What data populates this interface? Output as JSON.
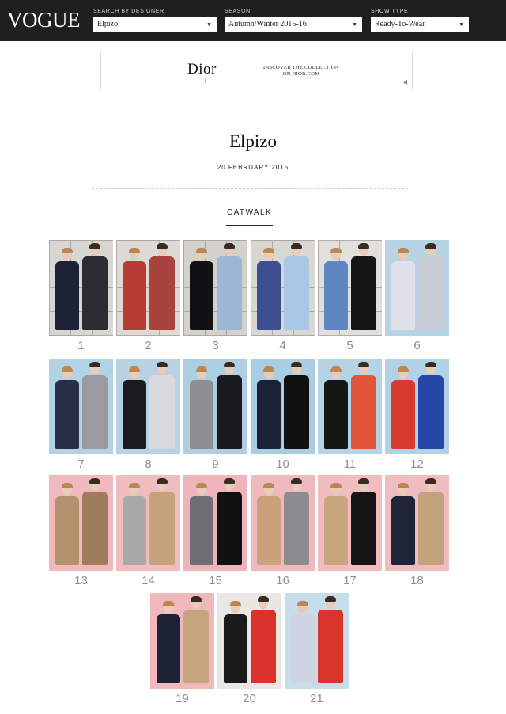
{
  "header": {
    "logo": "VOGUE",
    "filters": [
      {
        "label": "SEARCH BY DESIGNER",
        "value": "Elpizo"
      },
      {
        "label": "SEASON",
        "value": "Autumn/Winter 2015-16"
      },
      {
        "label": "SHOW TYPE",
        "value": "Ready-To-Wear"
      }
    ],
    "caret": "▼"
  },
  "ad": {
    "brand": "Dior",
    "cta_line1": "DISCOVER THE COLLECTION",
    "cta_line2": "ON DIOR.COM",
    "speaker_icon": "speaker-icon"
  },
  "show": {
    "title": "Elpizo",
    "date": "20 FEBRUARY 2015",
    "tab": "CATWALK"
  },
  "looks": [
    {
      "number": "1",
      "bg": "#d8d6d2",
      "pattern": "grid",
      "outfits": [
        "#1d2236",
        "#2c2c30"
      ]
    },
    {
      "number": "2",
      "bg": "#dddad5",
      "pattern": "grid",
      "outfits": [
        "#b83a35",
        "#a8433e"
      ]
    },
    {
      "number": "3",
      "bg": "#d3d1cc",
      "pattern": "grid",
      "outfits": [
        "#111114",
        "#9ab8d6"
      ]
    },
    {
      "number": "4",
      "bg": "#d9d7d2",
      "pattern": "grid",
      "outfits": [
        "#3c4f8e",
        "#a9c8e8"
      ]
    },
    {
      "number": "5",
      "bg": "#e2e0dc",
      "pattern": "grid",
      "outfits": [
        "#5f86c2",
        "#151515"
      ]
    },
    {
      "number": "6",
      "bg": "#b8d4e4",
      "pattern": "plain",
      "outfits": [
        "#dfe2e8",
        "#c7ccd6"
      ]
    },
    {
      "number": "7",
      "bg": "#b3d2e3",
      "pattern": "plain",
      "outfits": [
        "#2a2f45",
        "#9a9aa0"
      ]
    },
    {
      "number": "8",
      "bg": "#b7d3e3",
      "pattern": "plain",
      "outfits": [
        "#1b1b1f",
        "#d9d9dd"
      ]
    },
    {
      "number": "9",
      "bg": "#aecfe2",
      "pattern": "plain",
      "outfits": [
        "#8f8f92",
        "#1a1a1d"
      ]
    },
    {
      "number": "10",
      "bg": "#a9cde3",
      "pattern": "plain",
      "outfits": [
        "#1b2236",
        "#111111"
      ]
    },
    {
      "number": "11",
      "bg": "#b4d3e4",
      "pattern": "plain",
      "outfits": [
        "#151515",
        "#e2553a"
      ]
    },
    {
      "number": "12",
      "bg": "#b1d1e4",
      "pattern": "plain",
      "outfits": [
        "#d83a2d",
        "#2747a8"
      ]
    },
    {
      "number": "13",
      "bg": "#efb9bd",
      "pattern": "plain",
      "outfits": [
        "#b4906c",
        "#a07c5c"
      ]
    },
    {
      "number": "14",
      "bg": "#efbcc0",
      "pattern": "plain",
      "outfits": [
        "#a9a9a9",
        "#c5a27c"
      ]
    },
    {
      "number": "15",
      "bg": "#edb5bb",
      "pattern": "plain",
      "outfits": [
        "#6e6e74",
        "#111111"
      ]
    },
    {
      "number": "16",
      "bg": "#eeb9bc",
      "pattern": "plain",
      "outfits": [
        "#c9a27b",
        "#8c8c90"
      ]
    },
    {
      "number": "17",
      "bg": "#f0bcc0",
      "pattern": "plain",
      "outfits": [
        "#c8a57e",
        "#141414"
      ]
    },
    {
      "number": "18",
      "bg": "#efbcc0",
      "pattern": "plain",
      "outfits": [
        "#1f2438",
        "#c4a27d"
      ]
    },
    {
      "number": "19",
      "bg": "#eeb8bc",
      "pattern": "plain",
      "outfits": [
        "#1c2236",
        "#c7a57f"
      ]
    },
    {
      "number": "20",
      "bg": "#e9e7e4",
      "pattern": "plain",
      "outfits": [
        "#1a1a1a",
        "#d8322a"
      ]
    },
    {
      "number": "21",
      "bg": "#c7dde9",
      "pattern": "plain",
      "outfits": [
        "#cfd4e3",
        "#d9342a"
      ]
    }
  ]
}
